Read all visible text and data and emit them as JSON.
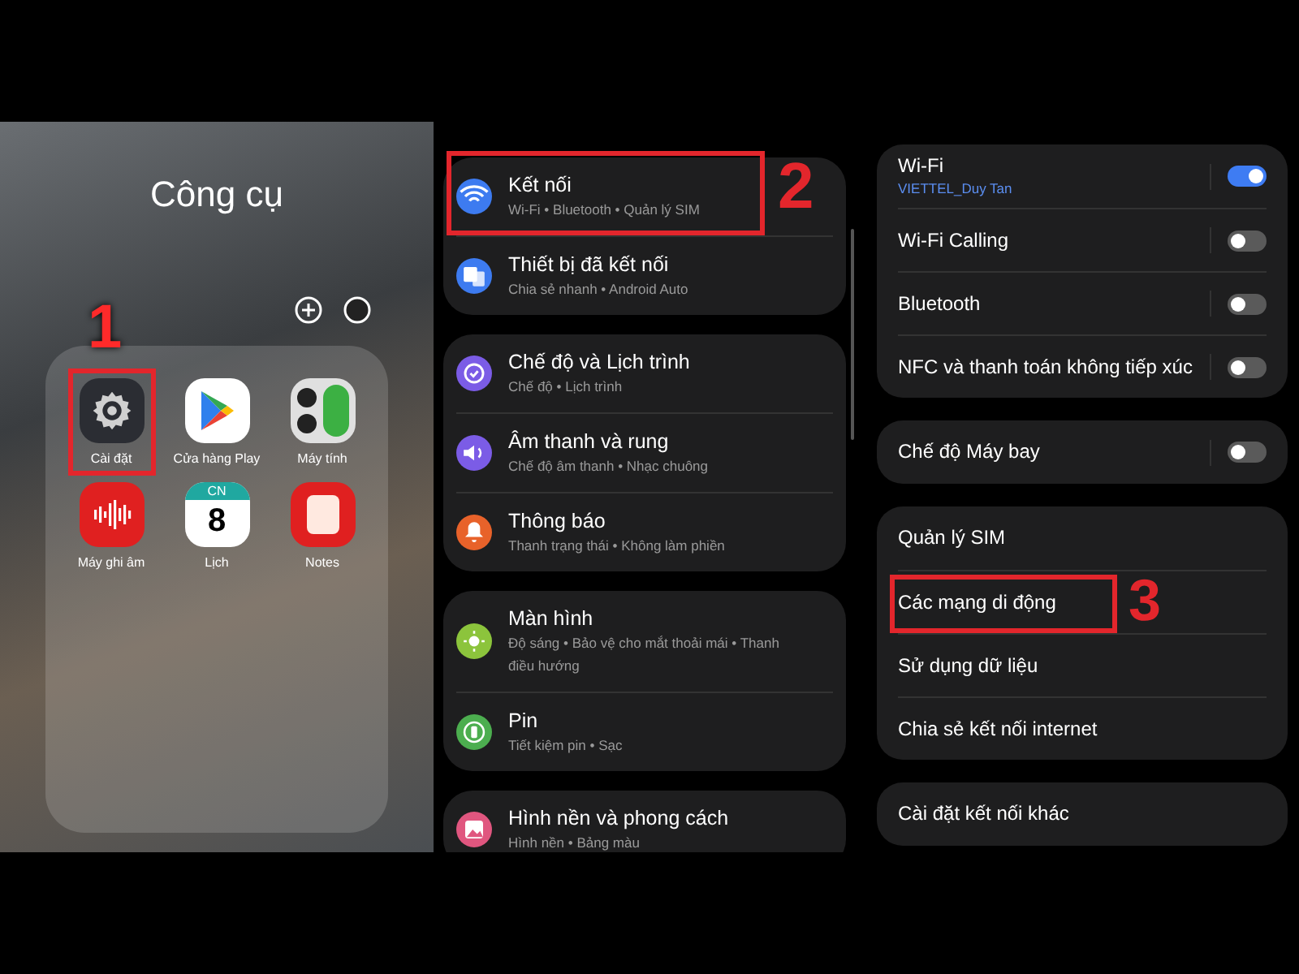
{
  "home": {
    "title": "Công cụ",
    "step": "1",
    "apps": [
      {
        "label": "Cài đặt",
        "kind": "settings",
        "highlighted": true
      },
      {
        "label": "Cửa hàng Play",
        "kind": "play",
        "highlighted": false
      },
      {
        "label": "Máy tính",
        "kind": "calculator",
        "highlighted": false
      },
      {
        "label": "Máy ghi âm",
        "kind": "recorder",
        "highlighted": false
      },
      {
        "label": "Lịch",
        "kind": "calendar",
        "highlighted": false,
        "badge": "CN",
        "day": "8"
      },
      {
        "label": "Notes",
        "kind": "notes",
        "highlighted": false
      }
    ]
  },
  "settings": {
    "step": "2",
    "groups": [
      {
        "items": [
          {
            "title": "Kết nối",
            "subtitle": "Wi-Fi • Bluetooth • Quản lý SIM",
            "kind": "wifi",
            "color": "#3d7bf0",
            "highlighted": true
          },
          {
            "title": "Thiết bị đã kết nối",
            "subtitle": "Chia sẻ nhanh • Android Auto",
            "kind": "devices",
            "color": "#3d7bf0",
            "highlighted": false
          }
        ]
      },
      {
        "items": [
          {
            "title": "Chế độ và Lịch trình",
            "subtitle": "Chế độ • Lịch trình",
            "kind": "modes",
            "color": "#7b5ce6",
            "highlighted": false
          },
          {
            "title": "Âm thanh và rung",
            "subtitle": "Chế độ âm thanh • Nhạc chuông",
            "kind": "sound",
            "color": "#7b5ce6",
            "highlighted": false
          },
          {
            "title": "Thông báo",
            "subtitle": "Thanh trạng thái • Không làm phiền",
            "kind": "bell",
            "color": "#e8622a",
            "highlighted": false
          }
        ]
      },
      {
        "items": [
          {
            "title": "Màn hình",
            "subtitle": "Độ sáng • Bảo vệ cho mắt thoải mái • Thanh điều hướng",
            "kind": "display",
            "color": "#8cc43c",
            "highlighted": false
          },
          {
            "title": "Pin",
            "subtitle": "Tiết kiệm pin • Sạc",
            "kind": "battery",
            "color": "#4cae4f",
            "highlighted": false
          }
        ]
      },
      {
        "items": [
          {
            "title": "Hình nền và phong cách",
            "subtitle": "Hình nền • Bảng màu",
            "kind": "wallpaper",
            "color": "#e0567f",
            "highlighted": false
          }
        ]
      }
    ]
  },
  "connections": {
    "step": "3",
    "groups": [
      {
        "items": [
          {
            "label": "Wi-Fi",
            "sublabel": "VIETTEL_Duy Tan",
            "kind": "toggle",
            "on": true,
            "highlighted": false
          },
          {
            "label": "Wi-Fi Calling",
            "kind": "toggle",
            "on": false,
            "highlighted": false
          },
          {
            "label": "Bluetooth",
            "kind": "toggle",
            "on": false,
            "highlighted": false
          },
          {
            "label": "NFC và thanh toán không tiếp xúc",
            "kind": "toggle",
            "on": false,
            "highlighted": false
          }
        ]
      },
      {
        "items": [
          {
            "label": "Chế độ Máy bay",
            "kind": "toggle",
            "on": false,
            "highlighted": false
          }
        ]
      },
      {
        "items": [
          {
            "label": "Quản lý SIM",
            "kind": "link",
            "highlighted": false
          },
          {
            "label": "Các mạng di động",
            "kind": "link",
            "highlighted": true
          },
          {
            "label": "Sử dụng dữ liệu",
            "kind": "link",
            "highlighted": false
          },
          {
            "label": "Chia sẻ kết nối internet",
            "kind": "link",
            "highlighted": false
          }
        ]
      },
      {
        "items": [
          {
            "label": "Cài đặt kết nối khác",
            "kind": "link",
            "highlighted": false
          }
        ]
      }
    ]
  }
}
